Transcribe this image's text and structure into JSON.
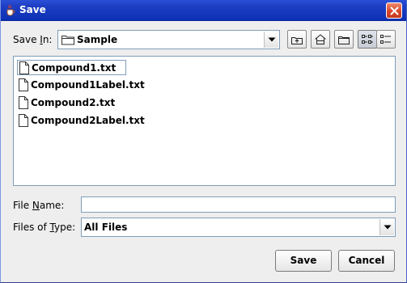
{
  "window": {
    "title": "Save",
    "app_icon": "java-cup-icon",
    "close_icon": "close-icon"
  },
  "save_in": {
    "label_prefix": "Save ",
    "label_mnemonic": "I",
    "label_suffix": "n:",
    "value": "Sample",
    "value_icon": "folder-icon"
  },
  "toolbar": [
    {
      "name": "up-one-level",
      "icon": "up-folder-icon",
      "active": false
    },
    {
      "name": "home",
      "icon": "home-icon",
      "active": false
    },
    {
      "name": "new-folder",
      "icon": "new-folder-icon",
      "active": false
    },
    {
      "name": "list-view",
      "icon": "list-view-icon",
      "active": true
    },
    {
      "name": "details-view",
      "icon": "details-view-icon",
      "active": false
    }
  ],
  "files": [
    {
      "name": "Compound1.txt",
      "selected": true
    },
    {
      "name": "Compound1Label.txt",
      "selected": false
    },
    {
      "name": "Compound2.txt",
      "selected": false
    },
    {
      "name": "Compound2Label.txt",
      "selected": false
    }
  ],
  "file_name": {
    "label_prefix": "File ",
    "label_mnemonic": "N",
    "label_suffix": "ame:",
    "value": ""
  },
  "file_type": {
    "label_prefix": "Files of ",
    "label_mnemonic": "T",
    "label_suffix": "ype:",
    "value": "All Files"
  },
  "buttons": {
    "save": "Save",
    "cancel": "Cancel"
  },
  "colors": {
    "titlebar": "#0b2fb3",
    "background": "#eeeeee",
    "border": "#7f9db9",
    "close": "#d8472b"
  }
}
